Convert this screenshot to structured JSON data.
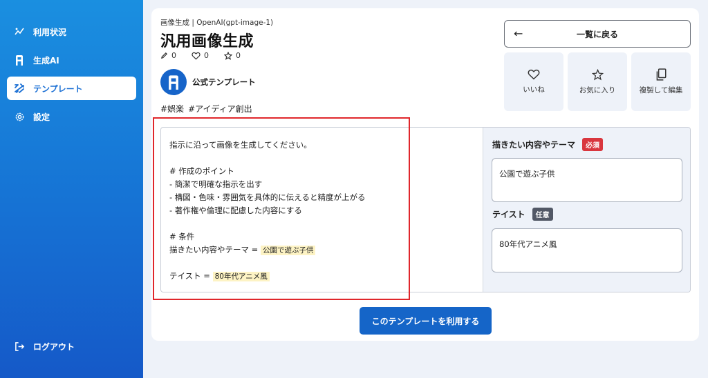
{
  "sidebar": {
    "items": [
      {
        "label": "利用状況",
        "icon": "chart-line-icon"
      },
      {
        "label": "生成AI",
        "icon": "logo-a-icon"
      },
      {
        "label": "テンプレート",
        "icon": "template-grid-icon",
        "active": true
      },
      {
        "label": "設定",
        "icon": "gear-icon"
      }
    ],
    "logout": {
      "label": "ログアウト",
      "icon": "logout-icon"
    }
  },
  "header": {
    "breadcrumb": "画像生成 | OpenAI(gpt-image-1)",
    "title": "汎用画像生成",
    "stats": {
      "edits": "0",
      "likes": "0",
      "favorites": "0"
    },
    "author": "公式テンプレート",
    "tags": [
      "#娯楽",
      "#アイディア創出"
    ]
  },
  "actions": {
    "back": "一覧に戻る",
    "like": "いいね",
    "favorite": "お気に入り",
    "duplicate": "複製して編集"
  },
  "prompt": {
    "line1": "指示に沿って画像を生成してください。",
    "line2": "# 作成のポイント",
    "line3": "- 簡潔で明確な指示を出す",
    "line4": "- 構図・色味・雰囲気を具体的に伝えると精度が上がる",
    "line5": "- 著作権や倫理に配慮した内容にする",
    "line6": "# 条件",
    "line7_label": "描きたい内容やテーマ = ",
    "line7_value": "公園で遊ぶ子供",
    "line8_label": "テイスト = ",
    "line8_value": "80年代アニメ風"
  },
  "variables": {
    "theme": {
      "label": "描きたい内容やテーマ",
      "badge": "必須",
      "value": "公園で遊ぶ子供"
    },
    "taste": {
      "label": "テイスト",
      "badge": "任意",
      "value": "80年代アニメ風"
    }
  },
  "use_button": "このテンプレートを利用する",
  "colors": {
    "accent": "#1565c8",
    "required": "#d9363e",
    "highlight": "#fdf3c4"
  }
}
